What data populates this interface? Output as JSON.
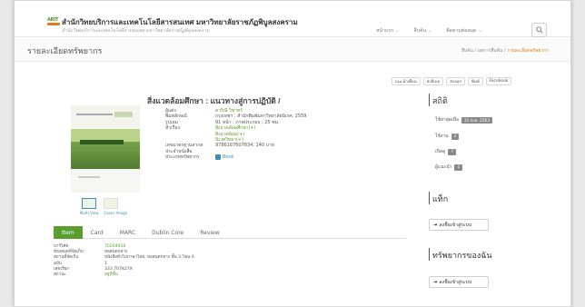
{
  "header": {
    "logo_text": "ARIT",
    "title": "สำนักวิทยบริการและเทคโนโลยีสารสนเทศ มหาวิทยาลัยราชภัฏพิบูลสงคราม",
    "subtitle": "สำนักวิทยบริการและเทคโนโลยีสารสนเทศ มหาวิทยาลัยราชภัฏพิบูลสงคราม",
    "nav": [
      "หน้าแรก",
      "สืบค้น",
      "ติดตามต่อสมุด"
    ]
  },
  "page": {
    "title": "รายละเอียดทรัพยากร",
    "breadcrumb": [
      "สืบค้น",
      "ผลการสืบค้น",
      "รายละเอียดทรัพยากร"
    ]
  },
  "actions": [
    "แนะนำเพื่อน",
    "ส่งอีเมล",
    "ส่งออก",
    "พิมพ์",
    "Facebook"
  ],
  "book": {
    "title": "สิ่งแวดล้อมศึกษา : แนวทางสู่การปฏิบัติ /",
    "meta": [
      {
        "k": "ผู้แต่ง",
        "v": "ดาริณี วิชาทร์",
        "link": true
      },
      {
        "k": "พิมพลักษณ์",
        "v": "กรุงเทพฯ : สำนักพิมพ์มหาวิทยาลัยนิเรศ, 2559",
        "link": false
      },
      {
        "k": "รูปเล่ม",
        "v": "91 หน้า : ภาพประกอบ ; 25 ซม.",
        "link": false
      },
      {
        "k": "หัวเรื่อง",
        "v": "สิ่งแวดล้อมศึกษา(+)",
        "link": true
      },
      {
        "k": "",
        "v": "สิ่งแวดล้อม(+)",
        "link": true
      },
      {
        "k": "",
        "v": "นิเวศวิทยา(+)",
        "link": true
      },
      {
        "k": "เลขมาตรฐานสากล",
        "v": "9786167607834: 140 บาท",
        "link": false
      },
      {
        "k": "ประจำหนังสือ",
        "v": "",
        "link": false
      },
      {
        "k": "ประเภททรัพยากร",
        "v": "Book",
        "link": false
      }
    ],
    "thumb_labels": [
      "Multi View",
      "Cover Image"
    ]
  },
  "sidebar": {
    "stats_title": "สถิติ",
    "stats": [
      {
        "label": "ใช้ล่าสุดเมื่อ",
        "value": "31 ต.ค. 2563"
      },
      {
        "label": "ใช้งาน",
        "value": "2"
      },
      {
        "label": "เปิดดู",
        "value": "7"
      },
      {
        "label": "ผู้แนะนำ",
        "value": "1"
      }
    ],
    "tag_title": "แท็ก",
    "tag_button": "ลงชื่อเข้าสู่ระบบ",
    "my_title": "ทรัพยากรของฉัน",
    "my_button": "ลงชื่อเข้าสู่ระบบ"
  },
  "tabs": [
    "Item",
    "Card",
    "MARC",
    "Dublin Core",
    "Review"
  ],
  "items": [
    {
      "k": "บาร์โค้ด",
      "v": "70204416",
      "green": true
    },
    {
      "k": "ห้องสมุดที่จัดเก็บ",
      "v": "หอสมุดกลาง",
      "green": false
    },
    {
      "k": "สถานที่จัดเก็บ",
      "v": "หนังสือทั่วไปภาษาไทย, หอสมุดกลาง ชั้น 3 โซน A",
      "green": false
    },
    {
      "k": "ฉบับ",
      "v": "1",
      "green": false
    },
    {
      "k": "เลขเรียก",
      "v": "333.707ด27ส",
      "green": false
    },
    {
      "k": "สถานะ",
      "v": "อยู่ที่ชั้น",
      "green": true
    }
  ]
}
